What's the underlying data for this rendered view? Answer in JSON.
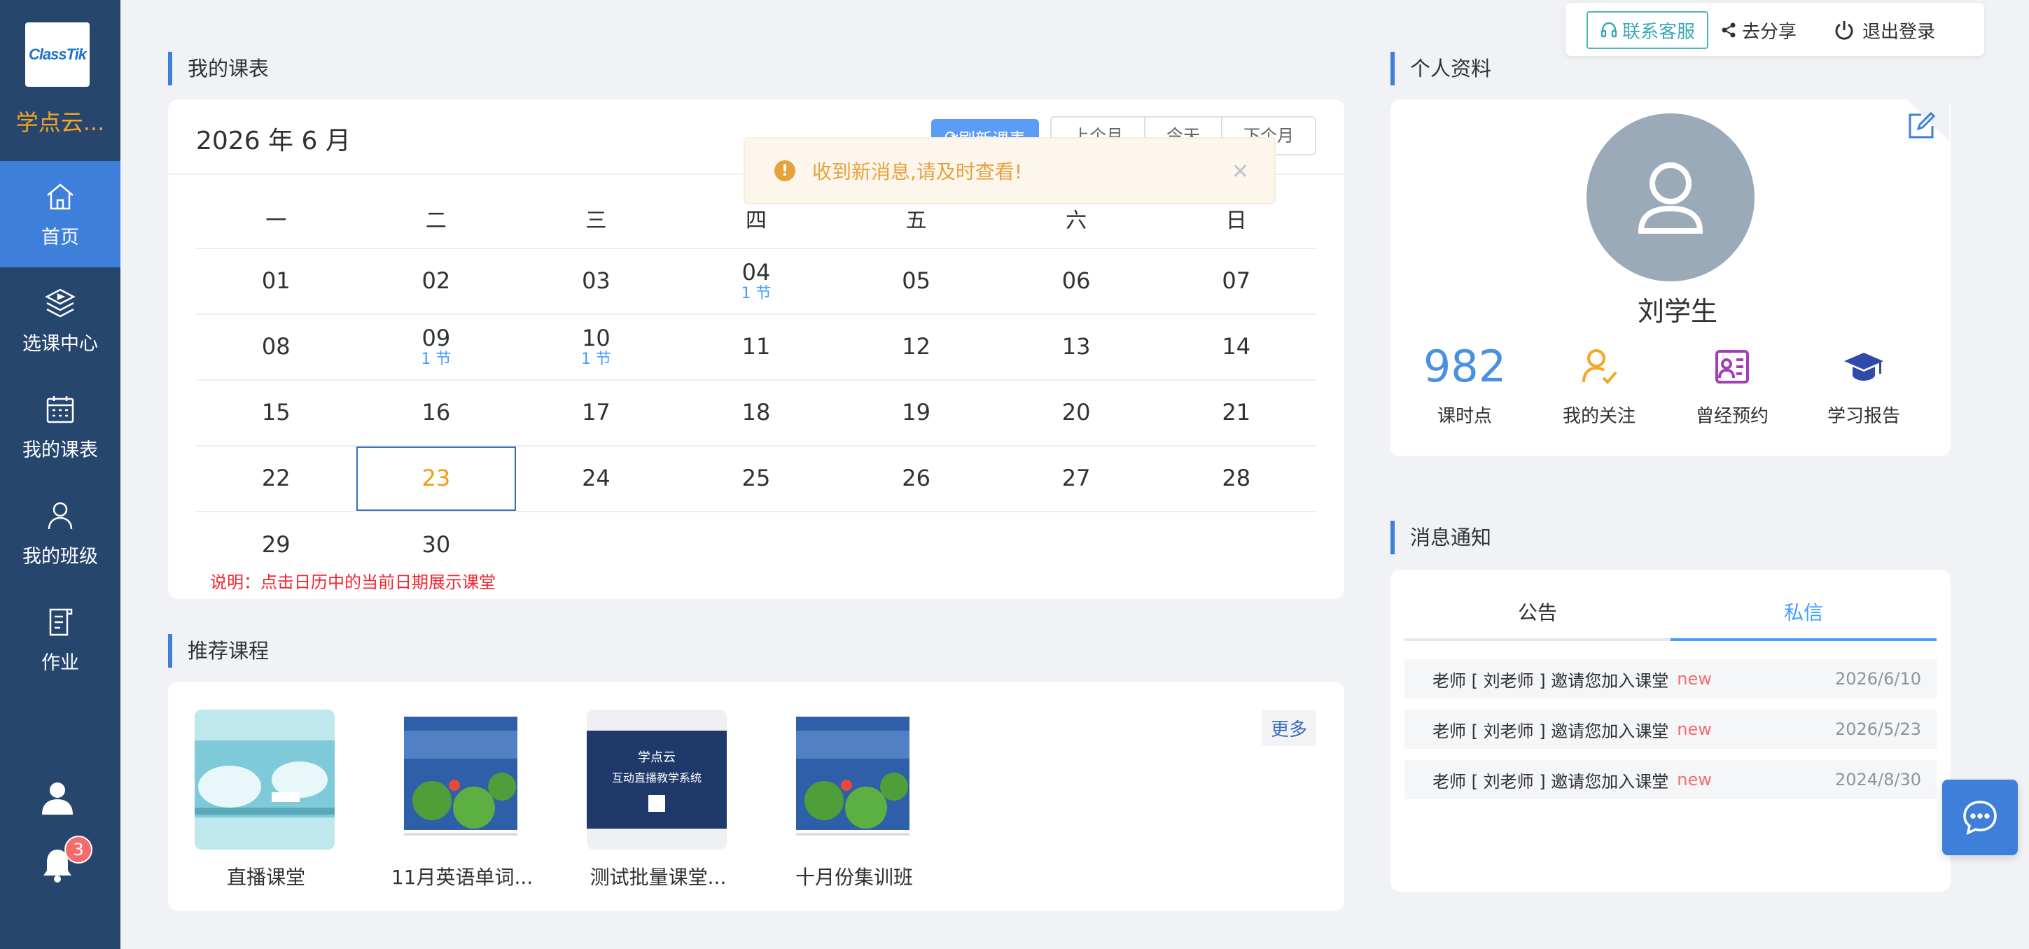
{
  "brand": {
    "logo": "ClassTik",
    "name": "学点云..."
  },
  "sidebar": {
    "items": [
      {
        "label": "首页",
        "icon": "home-icon",
        "active": true
      },
      {
        "label": "选课中心",
        "icon": "course-select-icon"
      },
      {
        "label": "我的课表",
        "icon": "calendar-icon"
      },
      {
        "label": "我的班级",
        "icon": "class-user-icon"
      },
      {
        "label": "作业",
        "icon": "homework-icon"
      }
    ],
    "notification_count": "3"
  },
  "toolbar": {
    "service": "联系客服",
    "share": "去分享",
    "logout": "退出登录"
  },
  "schedule": {
    "section_title": "我的课表",
    "month_title": "2026 年 6 月",
    "refresh_label": "刷新课表",
    "prev_month": "上个月",
    "today": "今天",
    "next_month": "下个月",
    "weekdays": [
      "一",
      "二",
      "三",
      "四",
      "五",
      "六",
      "日"
    ],
    "weeks": [
      [
        {
          "day": "01"
        },
        {
          "day": "02"
        },
        {
          "day": "03"
        },
        {
          "day": "04",
          "sub": "1 节"
        },
        {
          "day": "05"
        },
        {
          "day": "06"
        },
        {
          "day": "07"
        }
      ],
      [
        {
          "day": "08"
        },
        {
          "day": "09",
          "sub": "1 节"
        },
        {
          "day": "10",
          "sub": "1 节"
        },
        {
          "day": "11"
        },
        {
          "day": "12"
        },
        {
          "day": "13"
        },
        {
          "day": "14"
        }
      ],
      [
        {
          "day": "15"
        },
        {
          "day": "16"
        },
        {
          "day": "17"
        },
        {
          "day": "18"
        },
        {
          "day": "19"
        },
        {
          "day": "20"
        },
        {
          "day": "21"
        }
      ],
      [
        {
          "day": "22"
        },
        {
          "day": "23",
          "today": true
        },
        {
          "day": "24"
        },
        {
          "day": "25"
        },
        {
          "day": "26"
        },
        {
          "day": "27"
        },
        {
          "day": "28"
        }
      ],
      [
        {
          "day": "29"
        },
        {
          "day": "30"
        }
      ]
    ],
    "note": "说明：点击日历中的当前日期展示课堂"
  },
  "alert": {
    "message": "收到新消息,请及时查看!"
  },
  "recommended": {
    "section_title": "推荐课程",
    "more": "更多",
    "courses": [
      {
        "name": "直播课堂"
      },
      {
        "name": "11月英语单词..."
      },
      {
        "name": "测试批量课堂...",
        "thumb_title": "学点云",
        "thumb_subtitle": "互动直播教学系统"
      },
      {
        "name": "十月份集训班"
      }
    ]
  },
  "profile": {
    "section_title": "个人资料",
    "name": "刘学生",
    "stats": [
      {
        "value": "982",
        "label": "课时点"
      },
      {
        "icon": "follow-user-icon",
        "label": "我的关注"
      },
      {
        "icon": "booking-history-icon",
        "label": "曾经预约"
      },
      {
        "icon": "graduation-cap-icon",
        "label": "学习报告"
      }
    ]
  },
  "messages": {
    "section_title": "消息通知",
    "tabs": [
      "公告",
      "私信"
    ],
    "active_tab": 1,
    "items": [
      {
        "text": "老师 [ 刘老师 ] 邀请您加入课堂",
        "badge": "new",
        "date": "2026/6/10"
      },
      {
        "text": "老师 [ 刘老师 ] 邀请您加入课堂",
        "badge": "new",
        "date": "2026/5/23"
      },
      {
        "text": "老师 [ 刘老师 ] 邀请您加入课堂",
        "badge": "new",
        "date": "2024/8/30"
      }
    ]
  },
  "colors": {
    "sidebar": "#27466e",
    "active": "#3d7fd9",
    "accent": "#409eff",
    "brand": "#f5a623"
  }
}
